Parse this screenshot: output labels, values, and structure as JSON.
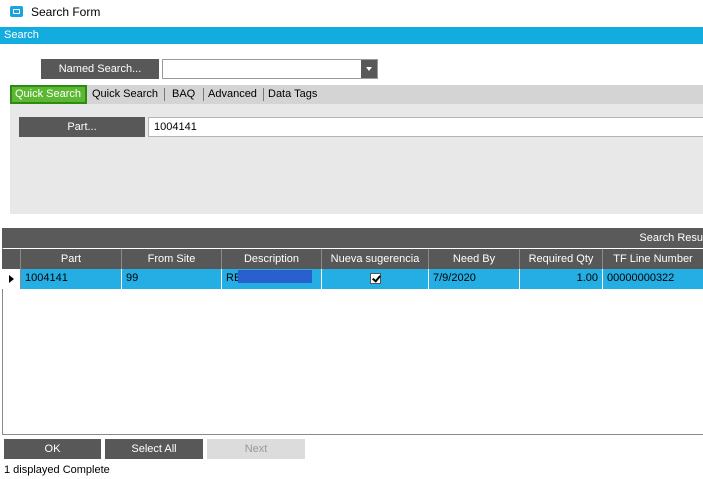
{
  "window": {
    "title": "Search Form"
  },
  "search": {
    "header": "Search",
    "named_search_label": "Named Search...",
    "named_search_value": ""
  },
  "tabs": [
    {
      "label": "Quick Search",
      "active": true
    },
    {
      "label": "Quick Search",
      "active": false
    },
    {
      "label": "BAQ",
      "active": false
    },
    {
      "label": "Advanced",
      "active": false
    },
    {
      "label": "Data Tags",
      "active": false
    }
  ],
  "quick_search": {
    "part_button": "Part...",
    "part_value": "1004141"
  },
  "results": {
    "caption": "Search Resu",
    "columns": [
      "Part",
      "From Site",
      "Description",
      "Nueva sugerencia",
      "Need By",
      "Required Qty",
      "TF Line Number"
    ],
    "rows": [
      {
        "part": "1004141",
        "from_site": "99",
        "description": "RE",
        "nueva_sugerencia": true,
        "need_by": "7/9/2020",
        "required_qty": "1.00",
        "tf_line_number": "00000000322"
      }
    ]
  },
  "buttons": {
    "ok": "OK",
    "select_all": "Select All",
    "next": "Next"
  },
  "status_text": "1 displayed Complete",
  "colors": {
    "accent": "#12acde",
    "selected_row": "#24aee3",
    "active_tab": "#5cb832",
    "dark_button": "#585858"
  },
  "icons": {
    "window": "form-icon",
    "dropdown": "chevron-down-icon",
    "row_pointer": "row-pointer-icon"
  }
}
